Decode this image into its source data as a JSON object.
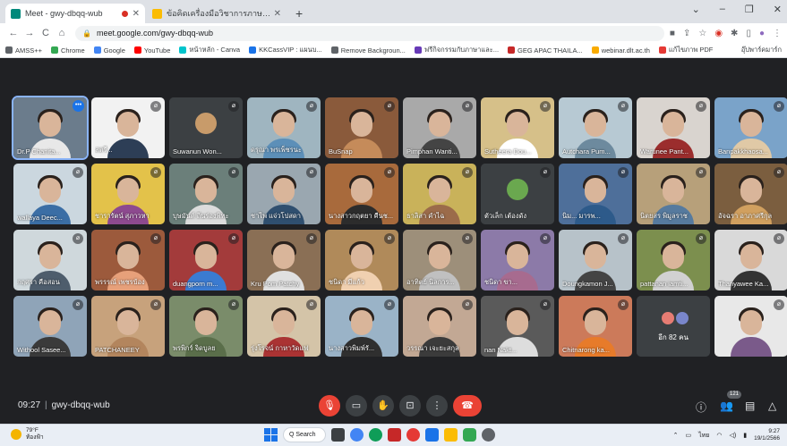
{
  "browser": {
    "tabs": [
      {
        "title": "Meet - gwy-dbqq-wub",
        "favicon_color": "#00897b",
        "recording": true,
        "active": true
      },
      {
        "title": "ข้อคิดเครื่องมือวิชาการภาษาไทย2564 - ...",
        "favicon_color": "#fbbc04",
        "recording": false,
        "active": false
      }
    ],
    "new_tab_glyph": "+",
    "window_controls": [
      "⌄",
      "–",
      "❐",
      "✕"
    ],
    "url": "meet.google.com/gwy-dbqq-wub",
    "nav_glyphs": {
      "back": "←",
      "forward": "→",
      "reload": "C",
      "home": "⌂"
    },
    "toolbar_icons": [
      "camera-icon",
      "share-icon",
      "star-icon",
      "extension-icon",
      "puzzle-icon",
      "sidebar-icon",
      "profile-icon",
      "menu-icon"
    ],
    "bookmarks": [
      {
        "label": "AMSS++",
        "color": "#5f6368"
      },
      {
        "label": "Chrome",
        "color": "#34a853"
      },
      {
        "label": "Google",
        "color": "#4285f4"
      },
      {
        "label": "YouTube",
        "color": "#ff0000"
      },
      {
        "label": "หน้าหลัก - Canva",
        "color": "#00c4cc"
      },
      {
        "label": "KKCassVIP : แผนบ...",
        "color": "#1a73e8"
      },
      {
        "label": "Remove Backgroun...",
        "color": "#5f6368"
      },
      {
        "label": "ฟรีกิจกรรมกับภาษาและ...",
        "color": "#673ab7"
      },
      {
        "label": "GEG APAC THAILA...",
        "color": "#c62828"
      },
      {
        "label": "webinar.dlt.ac.th",
        "color": "#f9ab00"
      },
      {
        "label": "แก้ไขภาพ PDF",
        "color": "#e53935"
      }
    ],
    "bookmarks_right": "อุ๊ปพาร์คมาร์ก"
  },
  "meeting": {
    "time": "09:27",
    "code": "gwy-dbqq-wub",
    "participant_count": "121",
    "others_label": "อีก 82 คน",
    "participants": [
      {
        "name": "Dr.P Chanita...",
        "bg": "#6b7c8c",
        "shirt": "#e8e8e8",
        "selected": true,
        "more": true
      },
      {
        "name": "สตรี...",
        "bg": "#f2f2f2",
        "shirt": "#2d3e56"
      },
      {
        "name": "Suwanun Won...",
        "bg": "#3c4043",
        "shirt": "#c89b6a",
        "avatar": true
      },
      {
        "name": "ดรุณา พรเพ็ชรนะ",
        "bg": "#9fb5c0",
        "shirt": "#5c8fb8"
      },
      {
        "name": "BuSnap",
        "bg": "#8a5a3b",
        "shirt": "#c58b5a"
      },
      {
        "name": "Pimphan Wanti...",
        "bg": "#a9a9a9",
        "shirt": "#444"
      },
      {
        "name": "Sutheera Dou...",
        "bg": "#d6c089",
        "shirt": "#ffffff"
      },
      {
        "name": "Autchara Pum...",
        "bg": "#b7c9d3",
        "shirt": "#6d8a9e"
      },
      {
        "name": "Warunee Pant...",
        "bg": "#d9d4cf",
        "shirt": "#9b2d2d"
      },
      {
        "name": "Banpakkhaosa...",
        "bg": "#7aa3c9",
        "shirt": "#e0c9a6"
      },
      {
        "name": "wallaya Deec...",
        "bg": "#cbd7df",
        "shirt": "#3b6ea5"
      },
      {
        "name": "ชารารัตน์ สุภาวหา",
        "bg": "#e3c24a",
        "shirt": "#8d4a8f"
      },
      {
        "name": "บุษมันต์ ถิ่นร่องพิทะ",
        "bg": "#6b7f7a",
        "shirt": "#dcdcdc"
      },
      {
        "name": "ชาไพ แจ่วโปสดา",
        "bg": "#9aa7b0",
        "shirt": "#2f4f6f"
      },
      {
        "name": "นางสาวกฤตยา คืนช...",
        "bg": "#a86a3c",
        "shirt": "#2c2c2c"
      },
      {
        "name": "ธาลิสา คำไฉ",
        "bg": "#c9b25a",
        "shirt": "#9b6b4a"
      },
      {
        "name": "ตัวเล็ก เต้องดัง",
        "bg": "#3c4043",
        "shirt": "#6aa84f",
        "avatar": true
      },
      {
        "name": "นิม... มารพ...",
        "bg": "#4e6f9a",
        "shirt": "#2d5a8a"
      },
      {
        "name": "นิตยสร พิมูลราช",
        "bg": "#b7a07a",
        "shirt": "#567a9e"
      },
      {
        "name": "อัจฉรา อาภาศรีกุล",
        "bg": "#7b5e3f",
        "shirt": "#d1a05f"
      },
      {
        "name": "กฤศรา คือสอน",
        "bg": "#cfd8dc",
        "shirt": "#4e5d6c"
      },
      {
        "name": "พรรรณ์ เพชรบ้อง",
        "bg": "#9c5a3c",
        "shirt": "#e7a07a"
      },
      {
        "name": "duangporn m...",
        "bg": "#a33b3b",
        "shirt": "#3b7bd1"
      },
      {
        "name": "Kru Pom Patchy",
        "bg": "#8a6f55",
        "shirt": "#e0e0e0"
      },
      {
        "name": "ชนิดา มีแก้ว",
        "bg": "#b08a5a",
        "shirt": "#f0d0b0"
      },
      {
        "name": "อาทิตย์ นิลการ...",
        "bg": "#9d8f7a",
        "shirt": "#c0c0c0"
      },
      {
        "name": "ชนิดา ขา...",
        "bg": "#8c7aa8",
        "shirt": "#a76b8f"
      },
      {
        "name": "Doungkamon J...",
        "bg": "#b7c2c9",
        "shirt": "#444"
      },
      {
        "name": "pattanan iamti...",
        "bg": "#7c8f4e",
        "shirt": "#d1d1d1"
      },
      {
        "name": "Thanyawee Ka...",
        "bg": "#d9d9d9",
        "shirt": "#333"
      },
      {
        "name": "Withool Sasee...",
        "bg": "#8fa4b8",
        "shirt": "#3a3a3a"
      },
      {
        "name": "PATCHANEEY",
        "bg": "#c7a27c",
        "shirt": "#b3855d"
      },
      {
        "name": "พรพิกร์ จิดบูลย",
        "bg": "#7a8c6a",
        "shirt": "#5a6e4a"
      },
      {
        "name": "รุ่งโรจน์ กาหาวัดแฟ",
        "bg": "#d4c4a8",
        "shirt": "#a33"
      },
      {
        "name": "นางสาวพิมพ์รั...",
        "bg": "#9ab3c7",
        "shirt": "#2f2f2f"
      },
      {
        "name": "วรรณา เจะยะสกุล",
        "bg": "#c2a894",
        "shirt": "#3b3b3b"
      },
      {
        "name": "nan Nakt...",
        "bg": "#5a5a5a",
        "shirt": "#ddd"
      },
      {
        "name": "Chitnarong ka...",
        "bg": "#cc7a5a",
        "shirt": "#e77b2a"
      },
      {
        "name": "อีก 82 คน",
        "bg": "#3c4043",
        "others": true
      },
      {
        "name": "",
        "bg": "#e8e8e8",
        "shirt": "#7a5a8a"
      }
    ],
    "controls": {
      "mic": "mic-off-icon",
      "camera": "camera-icon",
      "raise_hand": "raise-hand-icon",
      "present": "present-icon",
      "more": "more-icon",
      "leave": "leave-call-icon",
      "info": "info-icon",
      "people": "people-icon",
      "chat": "chat-icon",
      "activities": "activities-icon"
    }
  },
  "taskbar": {
    "weather_temp": "79°F",
    "weather_desc": "ท้องฟ้า",
    "search_label": "Q Search",
    "time": "9:27",
    "date": "19/1/2566",
    "lang": "ไทย"
  }
}
